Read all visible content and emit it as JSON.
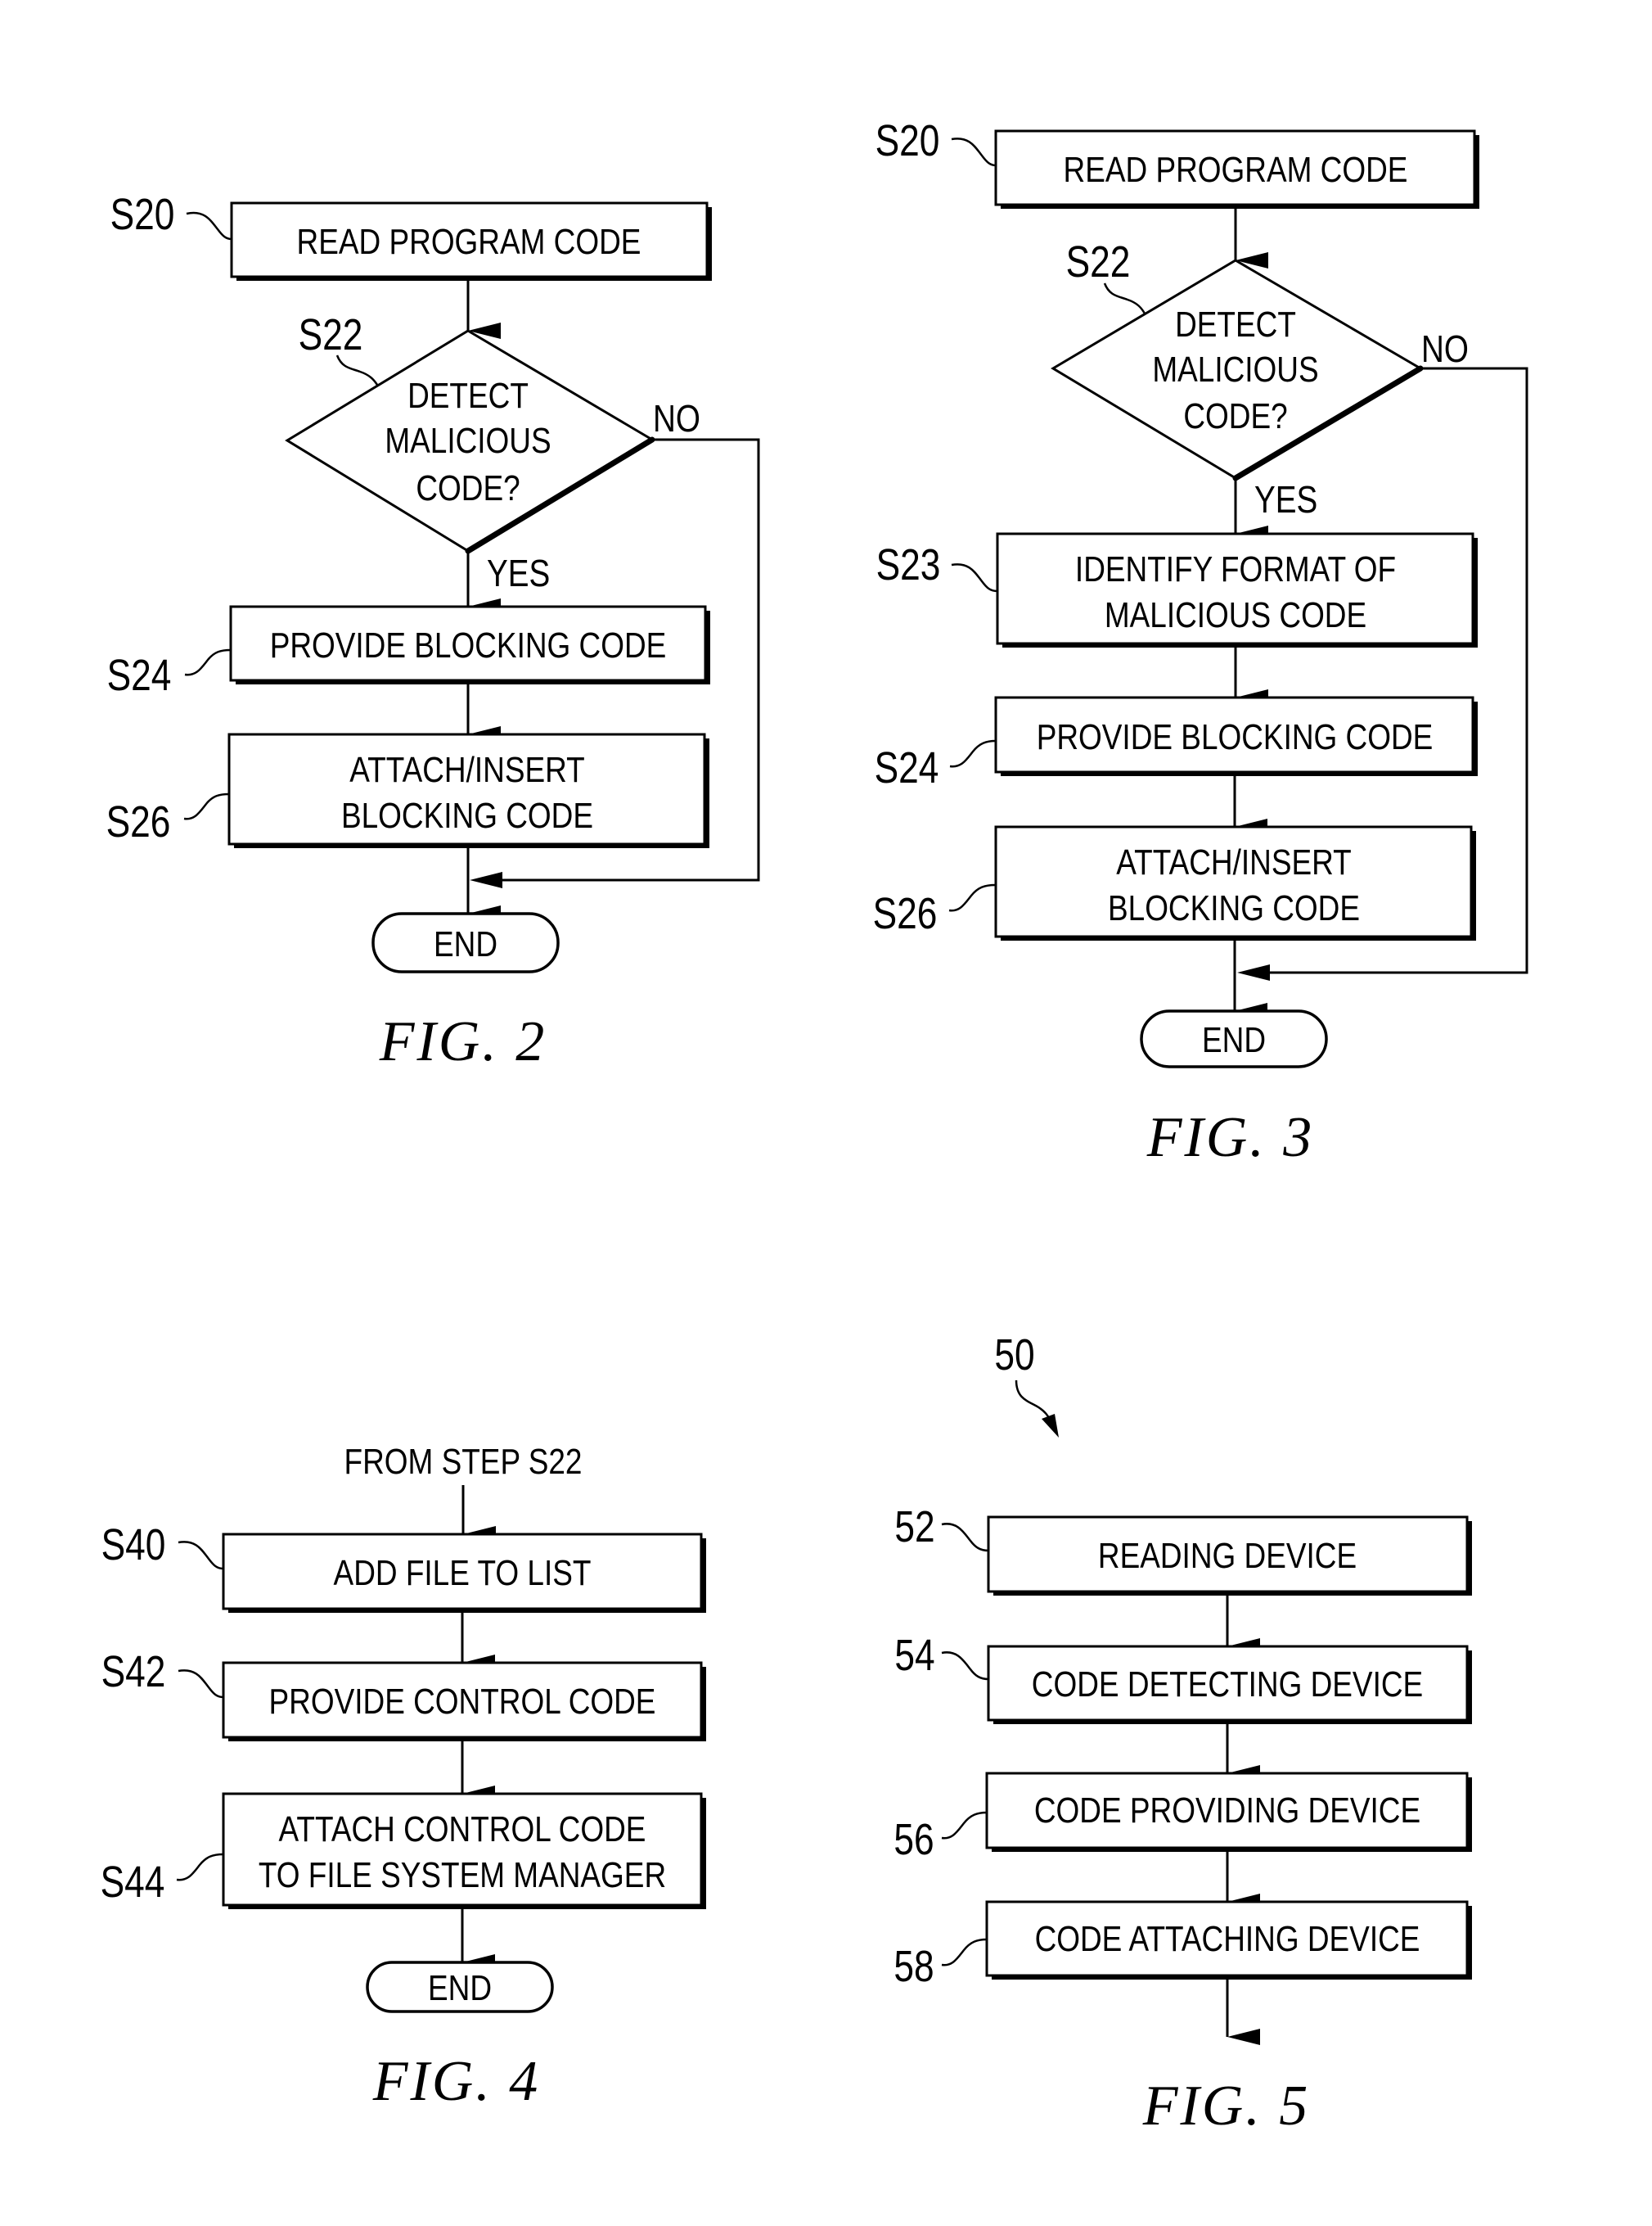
{
  "figures": {
    "fig2": {
      "caption": "FIG. 2",
      "steps": {
        "s20": {
          "label": "S20",
          "text": "READ PROGRAM CODE"
        },
        "s22": {
          "label": "S22",
          "lines": [
            "DETECT",
            "MALICIOUS",
            "CODE?"
          ]
        },
        "s24": {
          "label": "S24",
          "text": "PROVIDE BLOCKING CODE"
        },
        "s26": {
          "label": "S26",
          "lines": [
            "ATTACH/INSERT",
            "BLOCKING CODE"
          ]
        }
      },
      "branch_yes": "YES",
      "branch_no": "NO",
      "end": "END"
    },
    "fig3": {
      "caption": "FIG. 3",
      "steps": {
        "s20": {
          "label": "S20",
          "text": "READ PROGRAM CODE"
        },
        "s22": {
          "label": "S22",
          "lines": [
            "DETECT",
            "MALICIOUS",
            "CODE?"
          ]
        },
        "s23": {
          "label": "S23",
          "lines": [
            "IDENTIFY FORMAT OF",
            "MALICIOUS CODE"
          ]
        },
        "s24": {
          "label": "S24",
          "text": "PROVIDE BLOCKING CODE"
        },
        "s26": {
          "label": "S26",
          "lines": [
            "ATTACH/INSERT",
            "BLOCKING CODE"
          ]
        }
      },
      "branch_yes": "YES",
      "branch_no": "NO",
      "end": "END"
    },
    "fig4": {
      "caption": "FIG. 4",
      "entry": "FROM STEP S22",
      "steps": {
        "s40": {
          "label": "S40",
          "text": "ADD FILE TO LIST"
        },
        "s42": {
          "label": "S42",
          "text": "PROVIDE CONTROL CODE"
        },
        "s44": {
          "label": "S44",
          "lines": [
            "ATTACH CONTROL CODE",
            "TO FILE SYSTEM MANAGER"
          ]
        }
      },
      "end": "END"
    },
    "fig5": {
      "caption": "FIG. 5",
      "system_ref": "50",
      "devices": {
        "d52": {
          "label": "52",
          "text": "READING DEVICE"
        },
        "d54": {
          "label": "54",
          "text": "CODE DETECTING DEVICE"
        },
        "d56": {
          "label": "56",
          "text": "CODE PROVIDING DEVICE"
        },
        "d58": {
          "label": "58",
          "text": "CODE ATTACHING DEVICE"
        }
      }
    }
  },
  "colors": {
    "ink": "#000000",
    "paper": "#ffffff"
  }
}
